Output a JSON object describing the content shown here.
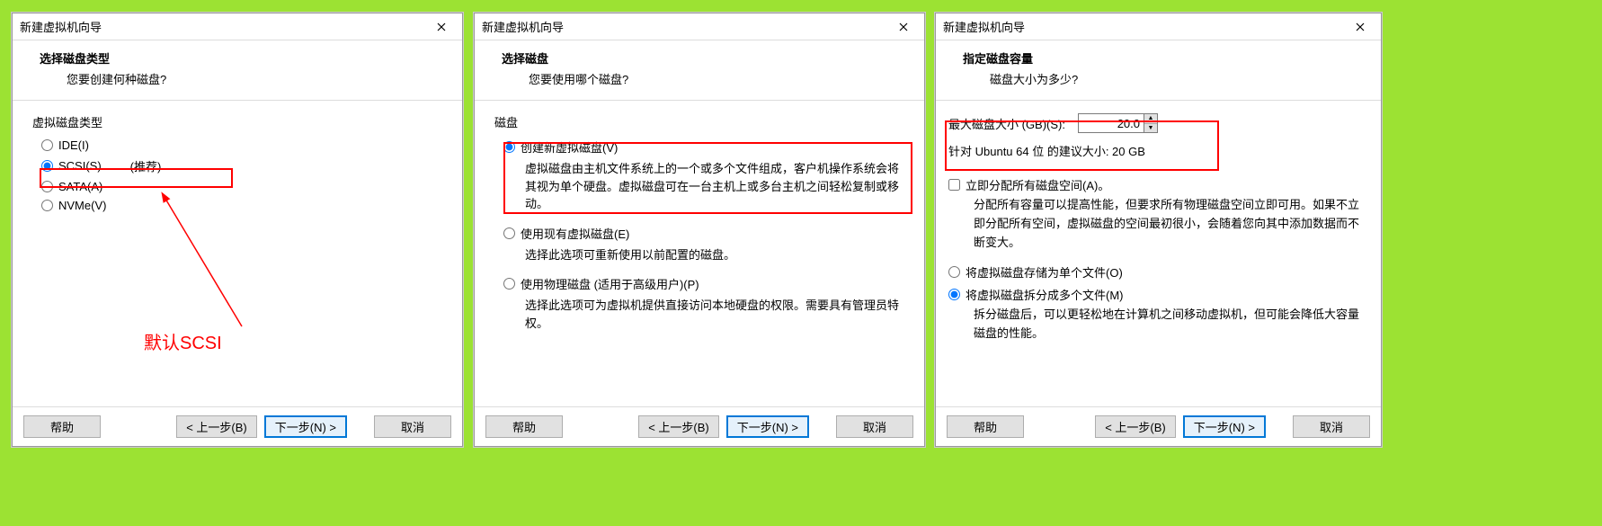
{
  "dialog1": {
    "window_title": "新建虚拟机向导",
    "header_title": "选择磁盘类型",
    "header_sub": "您要创建何种磁盘?",
    "group_label": "虚拟磁盘类型",
    "options": {
      "ide": "IDE(I)",
      "scsi": "SCSI(S)",
      "scsi_suffix": "(推荐)",
      "sata": "SATA(A)",
      "nvme": "NVMe(V)"
    },
    "buttons": {
      "help": "帮助",
      "back": "< 上一步(B)",
      "next": "下一步(N) >",
      "cancel": "取消"
    },
    "annotation": "默认SCSI"
  },
  "dialog2": {
    "window_title": "新建虚拟机向导",
    "header_title": "选择磁盘",
    "header_sub": "您要使用哪个磁盘?",
    "group_label": "磁盘",
    "option_create": "创建新虚拟磁盘(V)",
    "option_create_desc": "虚拟磁盘由主机文件系统上的一个或多个文件组成，客户机操作系统会将其视为单个硬盘。虚拟磁盘可在一台主机上或多台主机之间轻松复制或移动。",
    "option_existing": "使用现有虚拟磁盘(E)",
    "option_existing_desc": "选择此选项可重新使用以前配置的磁盘。",
    "option_physical": "使用物理磁盘 (适用于高级用户)(P)",
    "option_physical_desc": "选择此选项可为虚拟机提供直接访问本地硬盘的权限。需要具有管理员特权。",
    "buttons": {
      "help": "帮助",
      "back": "< 上一步(B)",
      "next": "下一步(N) >",
      "cancel": "取消"
    }
  },
  "dialog3": {
    "window_title": "新建虚拟机向导",
    "header_title": "指定磁盘容量",
    "header_sub": "磁盘大小为多少?",
    "max_size_label": "最大磁盘大小 (GB)(S):",
    "max_size_value": "20.0",
    "recommendation": "针对 Ubuntu 64 位 的建议大小: 20 GB",
    "allocate_now": "立即分配所有磁盘空间(A)。",
    "allocate_now_desc": "分配所有容量可以提高性能，但要求所有物理磁盘空间立即可用。如果不立即分配所有空间，虚拟磁盘的空间最初很小，会随着您向其中添加数据而不断变大。",
    "store_single": "将虚拟磁盘存储为单个文件(O)",
    "store_split": "将虚拟磁盘拆分成多个文件(M)",
    "store_split_desc": "拆分磁盘后，可以更轻松地在计算机之间移动虚拟机，但可能会降低大容量磁盘的性能。",
    "buttons": {
      "help": "帮助",
      "back": "< 上一步(B)",
      "next": "下一步(N) >",
      "cancel": "取消"
    }
  }
}
